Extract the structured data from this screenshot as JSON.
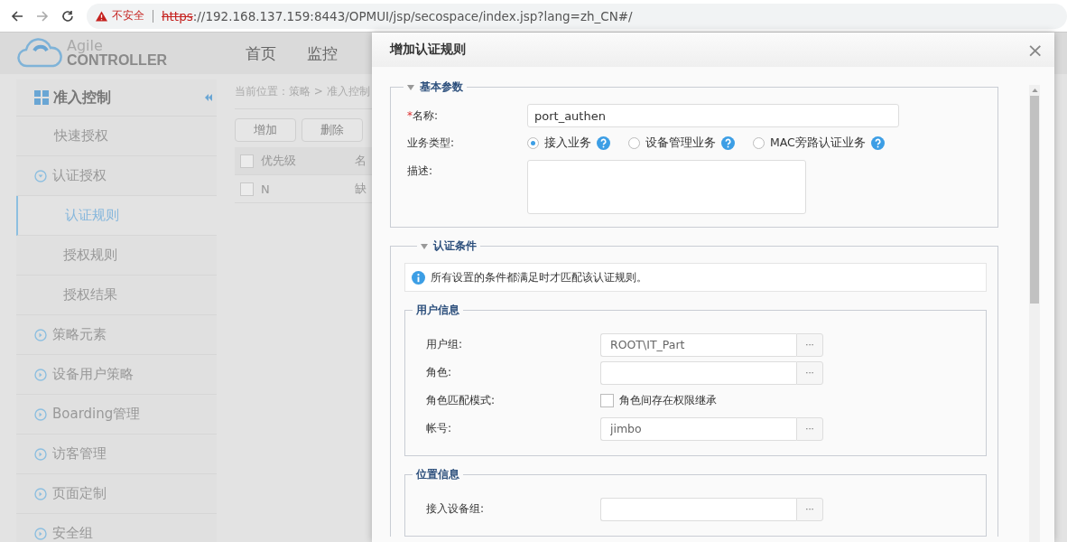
{
  "browser": {
    "warning": "不安全",
    "scheme": "https",
    "url_rest": "://192.168.137.159:8443/OPMUI/jsp/secospace/index.jsp?lang=zh_CN#/"
  },
  "header": {
    "logo_top": "Agile",
    "logo_bottom": "CONTROLLER",
    "nav": [
      {
        "label": "首页",
        "selected": false
      },
      {
        "label": "监控",
        "selected": false
      }
    ]
  },
  "sidebar": {
    "title": "准入控制",
    "items": [
      {
        "label": "快速授权",
        "kind": "link",
        "selected": false
      },
      {
        "label": "认证授权",
        "kind": "group",
        "expanded": true,
        "children": [
          {
            "label": "认证规则",
            "selected": true
          },
          {
            "label": "授权规则",
            "selected": false
          },
          {
            "label": "授权结果",
            "selected": false
          }
        ]
      },
      {
        "label": "策略元素",
        "kind": "group",
        "expanded": false
      },
      {
        "label": "设备用户策略",
        "kind": "group",
        "expanded": false
      },
      {
        "label": "Boarding管理",
        "kind": "group",
        "expanded": false
      },
      {
        "label": "访客管理",
        "kind": "group",
        "expanded": false
      },
      {
        "label": "页面定制",
        "kind": "group",
        "expanded": false
      },
      {
        "label": "安全组",
        "kind": "group",
        "expanded": false
      }
    ]
  },
  "content": {
    "breadcrumb": "当前位置：策略 > 准入控制",
    "buttons": [
      "增加",
      "删除"
    ],
    "table": {
      "header_checked": false,
      "columns": [
        "优先级",
        "名"
      ],
      "rows": [
        {
          "checked": false,
          "cells": [
            "N",
            "缺"
          ]
        }
      ]
    }
  },
  "modal": {
    "title": "增加认证规则",
    "close": "×",
    "basic": {
      "legend": "基本参数",
      "expanded": true,
      "name": {
        "label": "名称:",
        "required_mark": "*",
        "value": "port_authen"
      },
      "service_type": {
        "label": "业务类型:",
        "options": [
          {
            "label": "接入业务",
            "selected": true
          },
          {
            "label": "设备管理业务",
            "selected": false
          },
          {
            "label": "MAC旁路认证业务",
            "selected": false
          }
        ]
      },
      "description": {
        "label": "描述:"
      }
    },
    "conditions": {
      "legend": "认证条件",
      "expanded": true,
      "notice": "所有设置的条件都满足时才匹配该认证规则。",
      "groups": [
        {
          "legend": "用户信息",
          "fields": [
            {
              "kind": "picker",
              "label": "用户组:",
              "value": "ROOT\\IT_Part",
              "button": "···"
            },
            {
              "kind": "picker",
              "label": "角色:",
              "button": "···"
            },
            {
              "kind": "checkbox",
              "label": "角色匹配模式:",
              "option": "角色间存在权限继承",
              "checked": false
            },
            {
              "kind": "picker",
              "label": "帐号:",
              "value": "jimbo",
              "button": "···"
            }
          ]
        },
        {
          "legend": "位置信息",
          "fields": [
            {
              "kind": "picker",
              "label": "接入设备组:",
              "button": "···"
            }
          ]
        }
      ]
    }
  }
}
